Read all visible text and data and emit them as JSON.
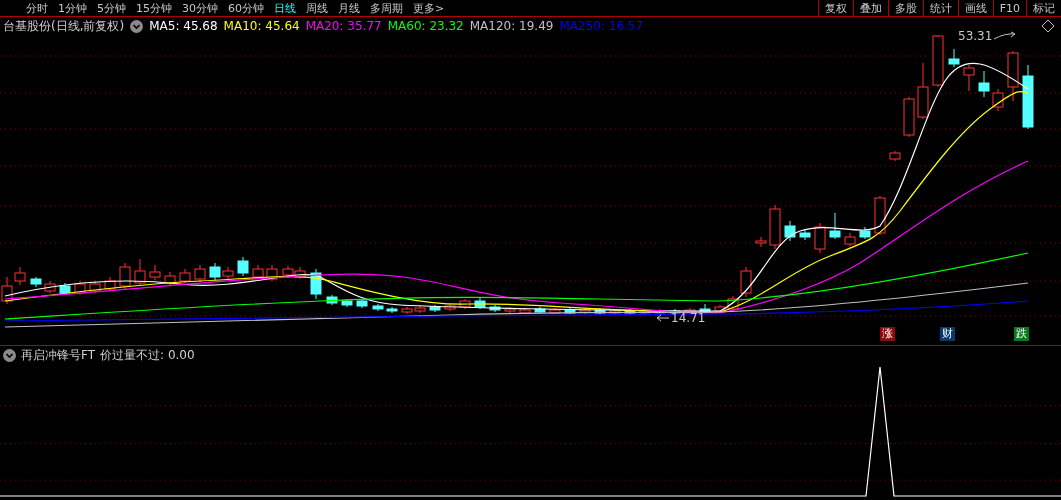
{
  "top_bar": {
    "periods": [
      {
        "label": "分时",
        "selected": false
      },
      {
        "label": "1分钟",
        "selected": false
      },
      {
        "label": "5分钟",
        "selected": false
      },
      {
        "label": "15分钟",
        "selected": false
      },
      {
        "label": "30分钟",
        "selected": false
      },
      {
        "label": "60分钟",
        "selected": false
      },
      {
        "label": "日线",
        "selected": true
      },
      {
        "label": "周线",
        "selected": false
      },
      {
        "label": "月线",
        "selected": false
      },
      {
        "label": "多周期",
        "selected": false
      },
      {
        "label": "更多>",
        "selected": false
      }
    ],
    "tools": [
      "复权",
      "叠加",
      "多股",
      "统计",
      "画线",
      "F10",
      "标记"
    ]
  },
  "legend": {
    "title": "台基股份(日线,前复权)",
    "averages": [
      {
        "label": "MA5: 45.68",
        "color": "#ffffff"
      },
      {
        "label": "MA10: 45.64",
        "color": "#ffff00"
      },
      {
        "label": "MA20: 35.77",
        "color": "#ff00ff"
      },
      {
        "label": "MA60: 23.32",
        "color": "#00ff00"
      },
      {
        "label": "MA120: 19.49",
        "color": "#c0c0c0"
      },
      {
        "label": "MA250: 16.57",
        "color": "#0000ff"
      }
    ]
  },
  "price_annotations": [
    {
      "kind": "high",
      "label": "53.31"
    },
    {
      "kind": "low",
      "label": "14.71"
    }
  ],
  "event_markers": [
    {
      "label": "涨",
      "color": "#8b0a0a"
    },
    {
      "label": "财",
      "color": "#0a3a6a"
    },
    {
      "label": "跌",
      "color": "#0a7a1e"
    }
  ],
  "indicator": {
    "title": "再启冲锋号FT",
    "reading": "价过量不过: 0.00"
  }
}
